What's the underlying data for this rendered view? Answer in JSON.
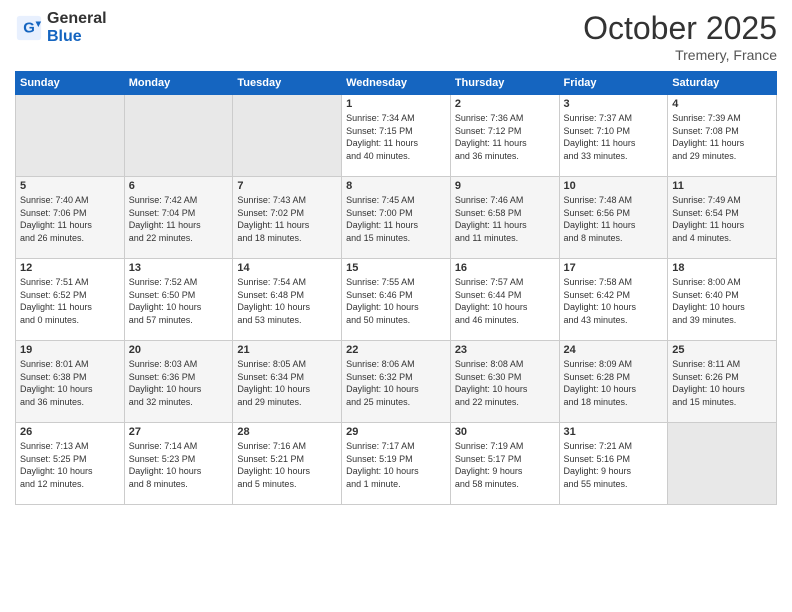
{
  "header": {
    "logo_general": "General",
    "logo_blue": "Blue",
    "month": "October 2025",
    "location": "Tremery, France"
  },
  "weekdays": [
    "Sunday",
    "Monday",
    "Tuesday",
    "Wednesday",
    "Thursday",
    "Friday",
    "Saturday"
  ],
  "weeks": [
    [
      {
        "day": "",
        "info": ""
      },
      {
        "day": "",
        "info": ""
      },
      {
        "day": "",
        "info": ""
      },
      {
        "day": "1",
        "info": "Sunrise: 7:34 AM\nSunset: 7:15 PM\nDaylight: 11 hours\nand 40 minutes."
      },
      {
        "day": "2",
        "info": "Sunrise: 7:36 AM\nSunset: 7:12 PM\nDaylight: 11 hours\nand 36 minutes."
      },
      {
        "day": "3",
        "info": "Sunrise: 7:37 AM\nSunset: 7:10 PM\nDaylight: 11 hours\nand 33 minutes."
      },
      {
        "day": "4",
        "info": "Sunrise: 7:39 AM\nSunset: 7:08 PM\nDaylight: 11 hours\nand 29 minutes."
      }
    ],
    [
      {
        "day": "5",
        "info": "Sunrise: 7:40 AM\nSunset: 7:06 PM\nDaylight: 11 hours\nand 26 minutes."
      },
      {
        "day": "6",
        "info": "Sunrise: 7:42 AM\nSunset: 7:04 PM\nDaylight: 11 hours\nand 22 minutes."
      },
      {
        "day": "7",
        "info": "Sunrise: 7:43 AM\nSunset: 7:02 PM\nDaylight: 11 hours\nand 18 minutes."
      },
      {
        "day": "8",
        "info": "Sunrise: 7:45 AM\nSunset: 7:00 PM\nDaylight: 11 hours\nand 15 minutes."
      },
      {
        "day": "9",
        "info": "Sunrise: 7:46 AM\nSunset: 6:58 PM\nDaylight: 11 hours\nand 11 minutes."
      },
      {
        "day": "10",
        "info": "Sunrise: 7:48 AM\nSunset: 6:56 PM\nDaylight: 11 hours\nand 8 minutes."
      },
      {
        "day": "11",
        "info": "Sunrise: 7:49 AM\nSunset: 6:54 PM\nDaylight: 11 hours\nand 4 minutes."
      }
    ],
    [
      {
        "day": "12",
        "info": "Sunrise: 7:51 AM\nSunset: 6:52 PM\nDaylight: 11 hours\nand 0 minutes."
      },
      {
        "day": "13",
        "info": "Sunrise: 7:52 AM\nSunset: 6:50 PM\nDaylight: 10 hours\nand 57 minutes."
      },
      {
        "day": "14",
        "info": "Sunrise: 7:54 AM\nSunset: 6:48 PM\nDaylight: 10 hours\nand 53 minutes."
      },
      {
        "day": "15",
        "info": "Sunrise: 7:55 AM\nSunset: 6:46 PM\nDaylight: 10 hours\nand 50 minutes."
      },
      {
        "day": "16",
        "info": "Sunrise: 7:57 AM\nSunset: 6:44 PM\nDaylight: 10 hours\nand 46 minutes."
      },
      {
        "day": "17",
        "info": "Sunrise: 7:58 AM\nSunset: 6:42 PM\nDaylight: 10 hours\nand 43 minutes."
      },
      {
        "day": "18",
        "info": "Sunrise: 8:00 AM\nSunset: 6:40 PM\nDaylight: 10 hours\nand 39 minutes."
      }
    ],
    [
      {
        "day": "19",
        "info": "Sunrise: 8:01 AM\nSunset: 6:38 PM\nDaylight: 10 hours\nand 36 minutes."
      },
      {
        "day": "20",
        "info": "Sunrise: 8:03 AM\nSunset: 6:36 PM\nDaylight: 10 hours\nand 32 minutes."
      },
      {
        "day": "21",
        "info": "Sunrise: 8:05 AM\nSunset: 6:34 PM\nDaylight: 10 hours\nand 29 minutes."
      },
      {
        "day": "22",
        "info": "Sunrise: 8:06 AM\nSunset: 6:32 PM\nDaylight: 10 hours\nand 25 minutes."
      },
      {
        "day": "23",
        "info": "Sunrise: 8:08 AM\nSunset: 6:30 PM\nDaylight: 10 hours\nand 22 minutes."
      },
      {
        "day": "24",
        "info": "Sunrise: 8:09 AM\nSunset: 6:28 PM\nDaylight: 10 hours\nand 18 minutes."
      },
      {
        "day": "25",
        "info": "Sunrise: 8:11 AM\nSunset: 6:26 PM\nDaylight: 10 hours\nand 15 minutes."
      }
    ],
    [
      {
        "day": "26",
        "info": "Sunrise: 7:13 AM\nSunset: 5:25 PM\nDaylight: 10 hours\nand 12 minutes."
      },
      {
        "day": "27",
        "info": "Sunrise: 7:14 AM\nSunset: 5:23 PM\nDaylight: 10 hours\nand 8 minutes."
      },
      {
        "day": "28",
        "info": "Sunrise: 7:16 AM\nSunset: 5:21 PM\nDaylight: 10 hours\nand 5 minutes."
      },
      {
        "day": "29",
        "info": "Sunrise: 7:17 AM\nSunset: 5:19 PM\nDaylight: 10 hours\nand 1 minute."
      },
      {
        "day": "30",
        "info": "Sunrise: 7:19 AM\nSunset: 5:17 PM\nDaylight: 9 hours\nand 58 minutes."
      },
      {
        "day": "31",
        "info": "Sunrise: 7:21 AM\nSunset: 5:16 PM\nDaylight: 9 hours\nand 55 minutes."
      },
      {
        "day": "",
        "info": ""
      }
    ]
  ]
}
